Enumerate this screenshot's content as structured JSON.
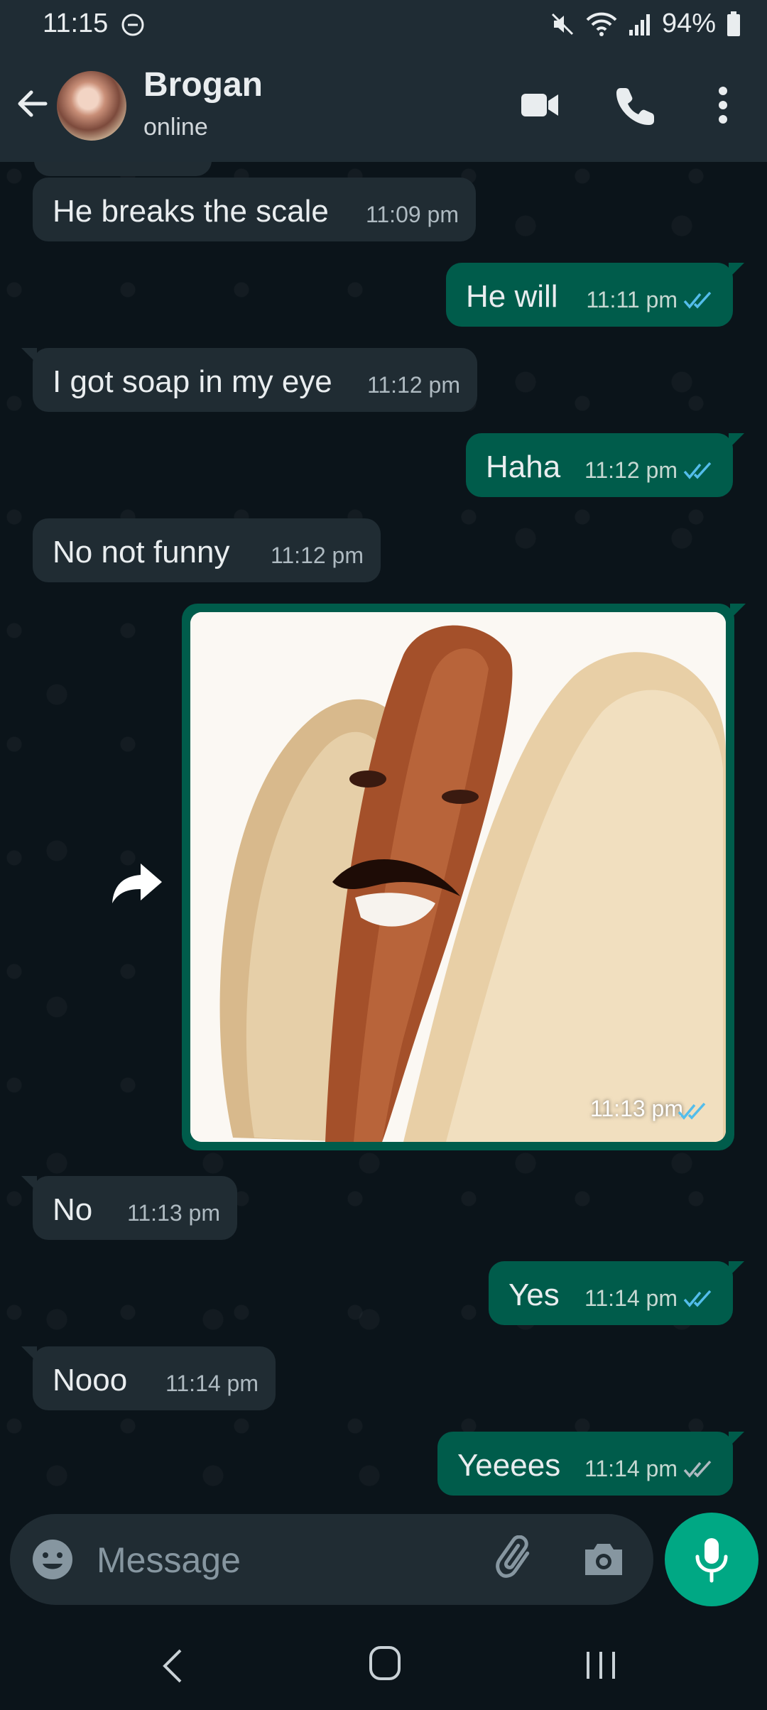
{
  "status_bar": {
    "time": "11:15",
    "battery": "94%",
    "icons": [
      "do-not-disturb-icon",
      "mute-icon",
      "wifi-icon",
      "signal-icon",
      "battery-icon"
    ]
  },
  "header": {
    "contact_name": "Brogan",
    "contact_status": "online",
    "icons": [
      "back-arrow-icon",
      "video-call-icon",
      "phone-call-icon",
      "more-options-icon"
    ]
  },
  "messages": [
    {
      "direction": "in",
      "text": "He breaks the scale",
      "time": "11:09 pm"
    },
    {
      "direction": "out",
      "text": "He will",
      "time": "11:11 pm",
      "read": true
    },
    {
      "direction": "in",
      "text": "I got soap in my eye",
      "time": "11:12 pm"
    },
    {
      "direction": "out",
      "text": "Haha",
      "time": "11:12 pm",
      "read": true
    },
    {
      "direction": "in",
      "text": "No not funny",
      "time": "11:12 pm"
    },
    {
      "direction": "out",
      "type": "image",
      "time": "11:13 pm",
      "read": true
    },
    {
      "direction": "in",
      "text": "No",
      "time": "11:13 pm"
    },
    {
      "direction": "out",
      "text": "Yes",
      "time": "11:14 pm",
      "read": true
    },
    {
      "direction": "in",
      "text": "Nooo",
      "time": "11:14 pm"
    },
    {
      "direction": "out",
      "text": "Yeeees",
      "time": "11:14 pm",
      "read": false
    }
  ],
  "input": {
    "placeholder": "Message"
  },
  "colors": {
    "background": "#0b141a",
    "header": "#1f2c34",
    "incoming_bubble": "#202c33",
    "outgoing_bubble": "#005c4b",
    "accent": "#00a884",
    "read_ticks": "#53bdeb"
  }
}
